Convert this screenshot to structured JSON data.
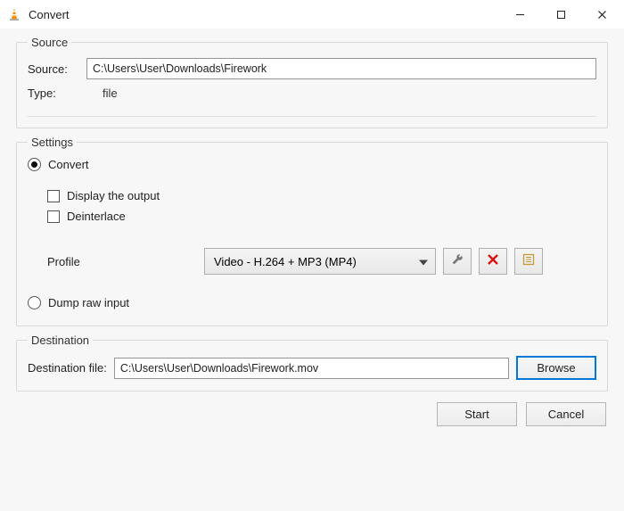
{
  "titlebar": {
    "title": "Convert"
  },
  "source": {
    "legend": "Source",
    "source_label": "Source:",
    "source_value": "C:\\Users\\User\\Downloads\\Firework",
    "type_label": "Type:",
    "type_value": "file"
  },
  "settings": {
    "legend": "Settings",
    "convert_label": "Convert",
    "display_output_label": "Display the output",
    "deinterlace_label": "Deinterlace",
    "profile_label": "Profile",
    "profile_value": "Video - H.264 + MP3 (MP4)",
    "dump_raw_label": "Dump raw input"
  },
  "destination": {
    "legend": "Destination",
    "dest_label": "Destination file:",
    "dest_value": "C:\\Users\\User\\Downloads\\Firework.mov",
    "browse_label": "Browse"
  },
  "footer": {
    "start_label": "Start",
    "cancel_label": "Cancel"
  }
}
